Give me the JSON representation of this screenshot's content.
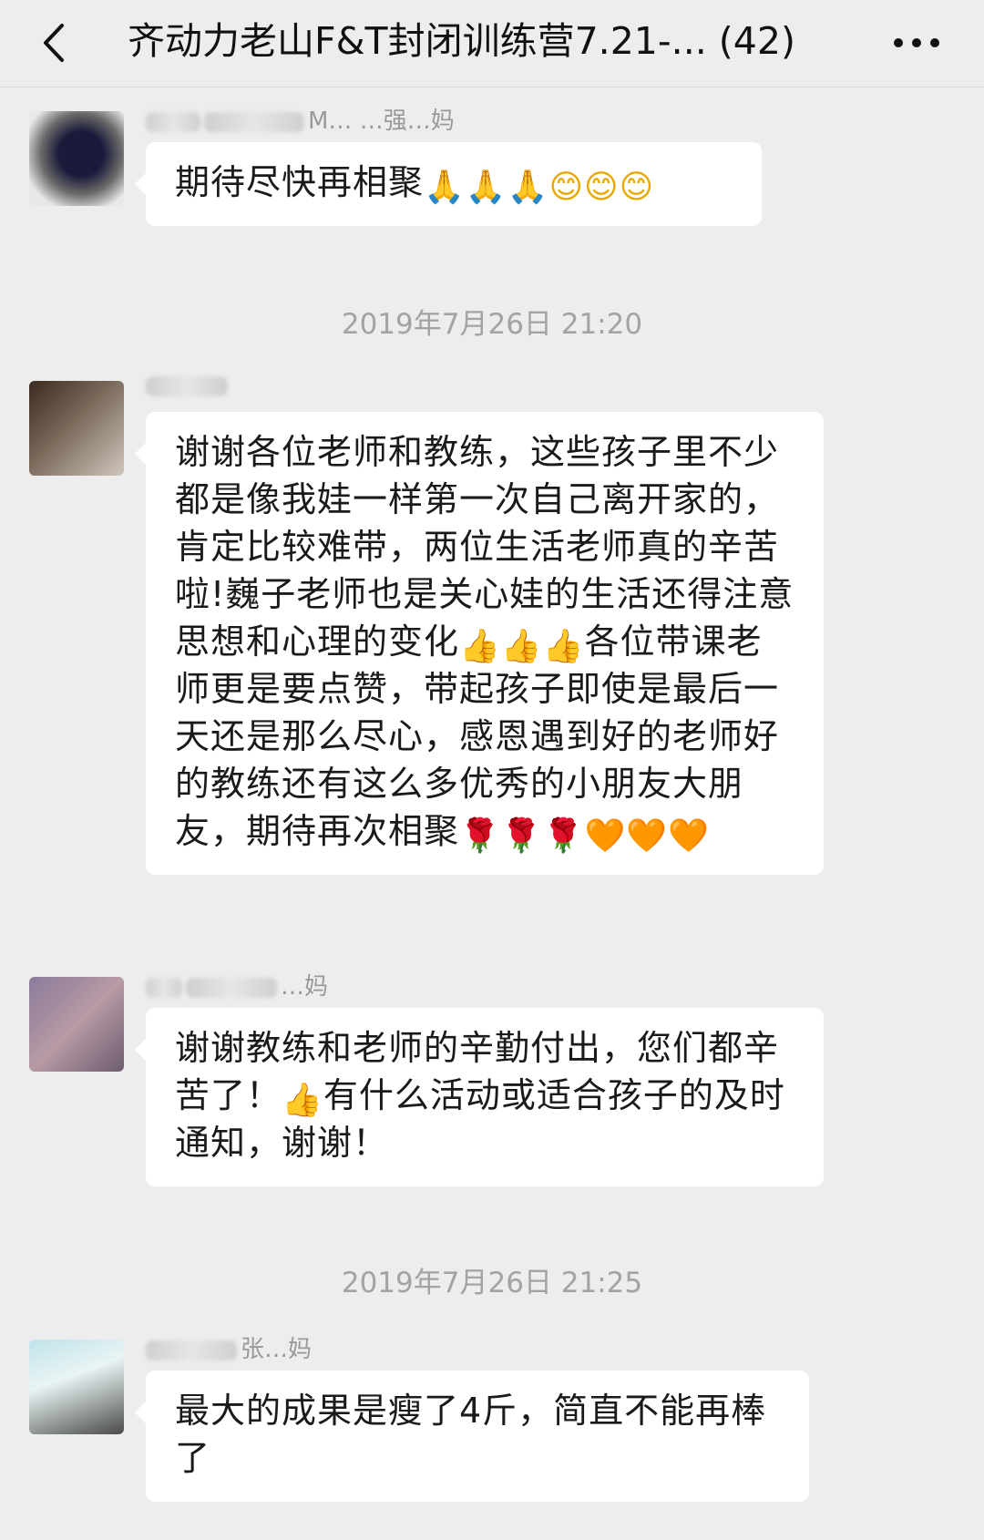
{
  "header": {
    "title": "齐动力老山F&T封闭训练营7.21-... (42)",
    "back_icon": "chevron-left-icon",
    "more_icon": "more-dots-icon"
  },
  "messages": [
    {
      "sender": "M… …强…妈",
      "segments": [
        {
          "t": "期待尽快再相聚"
        },
        {
          "e": "🙏",
          "name": "praying-hands-icon",
          "cls": "e-hands"
        },
        {
          "e": "🙏",
          "name": "praying-hands-icon",
          "cls": "e-hands"
        },
        {
          "e": "🙏",
          "name": "praying-hands-icon",
          "cls": "e-hands"
        },
        {
          "e": "😊",
          "name": "smile-icon",
          "cls": "e-smile"
        },
        {
          "e": "😊",
          "name": "smile-icon",
          "cls": "e-smile"
        },
        {
          "e": "😊",
          "name": "smile-icon",
          "cls": "e-smile"
        }
      ]
    },
    {
      "sender": "",
      "segments": [
        {
          "t": "谢谢各位老师和教练，这些孩子里不少都是像我娃一样第一次自己离开家的，肯定比较难带，两位生活老师真的辛苦啦!巍子老师也是关心娃的生活还得注意思想和心理的变化"
        },
        {
          "e": "👍",
          "name": "thumbs-up-icon",
          "cls": "e-thumb"
        },
        {
          "e": "👍",
          "name": "thumbs-up-icon",
          "cls": "e-thumb"
        },
        {
          "e": "👍",
          "name": "thumbs-up-icon",
          "cls": "e-thumb"
        },
        {
          "t": "各位带课老师更是要点赞，带起孩子即使是最后一天还是那么尽心，感恩遇到好的老师好的教练还有这么多优秀的小朋友大朋友，期待再次相聚"
        },
        {
          "e": "🌹",
          "name": "rose-icon",
          "cls": "e-rose"
        },
        {
          "e": "🌹",
          "name": "rose-icon",
          "cls": "e-rose"
        },
        {
          "e": "🌹",
          "name": "rose-icon",
          "cls": "e-rose"
        },
        {
          "e": "🧡",
          "name": "heart-icon",
          "cls": "e-heart"
        },
        {
          "e": "🧡",
          "name": "heart-icon",
          "cls": "e-heart"
        },
        {
          "e": "🧡",
          "name": "heart-icon",
          "cls": "e-heart"
        }
      ]
    },
    {
      "sender": "…妈",
      "segments": [
        {
          "t": "谢谢教练和老师的辛勤付出，您们都辛苦了！"
        },
        {
          "e": "👍",
          "name": "thumbs-up-icon",
          "cls": "e-thumb"
        },
        {
          "t": "有什么活动或适合孩子的及时通知，谢谢！"
        }
      ]
    },
    {
      "sender": "张…妈",
      "segments": [
        {
          "t": "最大的成果是瘦了4斤，简直不能再棒了"
        }
      ]
    }
  ],
  "timestamps": [
    "2019年7月26日 21:20",
    "2019年7月26日 21:25"
  ]
}
